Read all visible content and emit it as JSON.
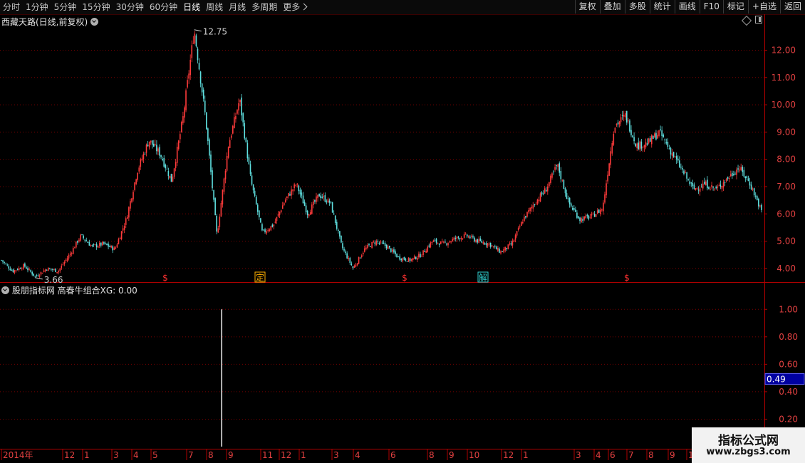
{
  "toolbar": {
    "periods": [
      "分时",
      "1分钟",
      "5分钟",
      "15分钟",
      "30分钟",
      "60分钟",
      "日线",
      "周线",
      "月线",
      "多周期",
      "更多"
    ],
    "active_period": "日线",
    "right_buttons": [
      "复权",
      "叠加",
      "多股",
      "统计",
      "画线",
      "F10",
      "标记",
      "+自选",
      "返回"
    ]
  },
  "main_panel": {
    "title": "西藏天路(日线,前复权)",
    "max_label": "12.75",
    "min_label": "3.66",
    "price_axis": [
      "12.00",
      "11.00",
      "10.00",
      "9.00",
      "8.00",
      "7.00",
      "6.00",
      "5.00",
      "4.00"
    ],
    "markers": [
      {
        "label": "$",
        "color": "#ff3030"
      },
      {
        "label": "定",
        "color": "#ffb000"
      },
      {
        "label": "$",
        "color": "#ff3030"
      },
      {
        "label": "解",
        "color": "#30d0d0"
      },
      {
        "label": "$",
        "color": "#ff3030"
      }
    ]
  },
  "indicator_panel": {
    "title": "股朋指标网 高春牛组合XG: 0.00",
    "axis": [
      "1.00",
      "0.80",
      "0.60",
      "0.40",
      "0.20"
    ],
    "current_value": "0.49"
  },
  "time_axis": [
    "2014年",
    "12",
    "1",
    "3",
    "4",
    "5",
    "7",
    "8",
    "9",
    "11",
    "12",
    "1",
    "3",
    "4",
    "6",
    "8",
    "9",
    "10",
    "12",
    "1",
    "3",
    "4",
    "6",
    "7",
    "8",
    "9",
    "1"
  ],
  "watermark": {
    "line1": "指标公式网",
    "line2": "www.zbgs3.com"
  },
  "colors": {
    "up": "#ff3b3b",
    "down": "#5fe0e0",
    "grid": "#7a0000",
    "axis": "#b00000",
    "signal": "#ffffff"
  },
  "chart_data": {
    "type": "candlestick",
    "y_axis": [
      3.5,
      12.9
    ],
    "key_prices": {
      "low": 3.66,
      "high": 12.75
    },
    "price_path": [
      4.3,
      3.9,
      4.1,
      3.7,
      4.0,
      3.9,
      4.5,
      5.2,
      4.8,
      4.9,
      4.7,
      5.8,
      7.6,
      8.7,
      8.2,
      7.2,
      9.5,
      12.75,
      9.5,
      5.2,
      8.5,
      10.2,
      7.2,
      5.3,
      5.6,
      6.5,
      7.1,
      6.0,
      6.7,
      6.4,
      4.8,
      4.0,
      4.7,
      5.0,
      4.8,
      4.4,
      4.3,
      4.5,
      5.0,
      4.9,
      5.1,
      5.2,
      5.0,
      4.9,
      4.6,
      4.9,
      5.8,
      6.4,
      6.9,
      7.8,
      6.4,
      5.8,
      5.9,
      6.2,
      9.2,
      9.6,
      8.5,
      8.6,
      9.0,
      8.3,
      7.6,
      6.9,
      7.1,
      6.9,
      7.3,
      7.7,
      7.1,
      6.1
    ],
    "indicator": {
      "name": "高春牛组合XG",
      "y_axis": [
        0,
        1.1
      ],
      "signal_position": 0.29,
      "signal_value": 1.0,
      "current": 0.49
    }
  }
}
